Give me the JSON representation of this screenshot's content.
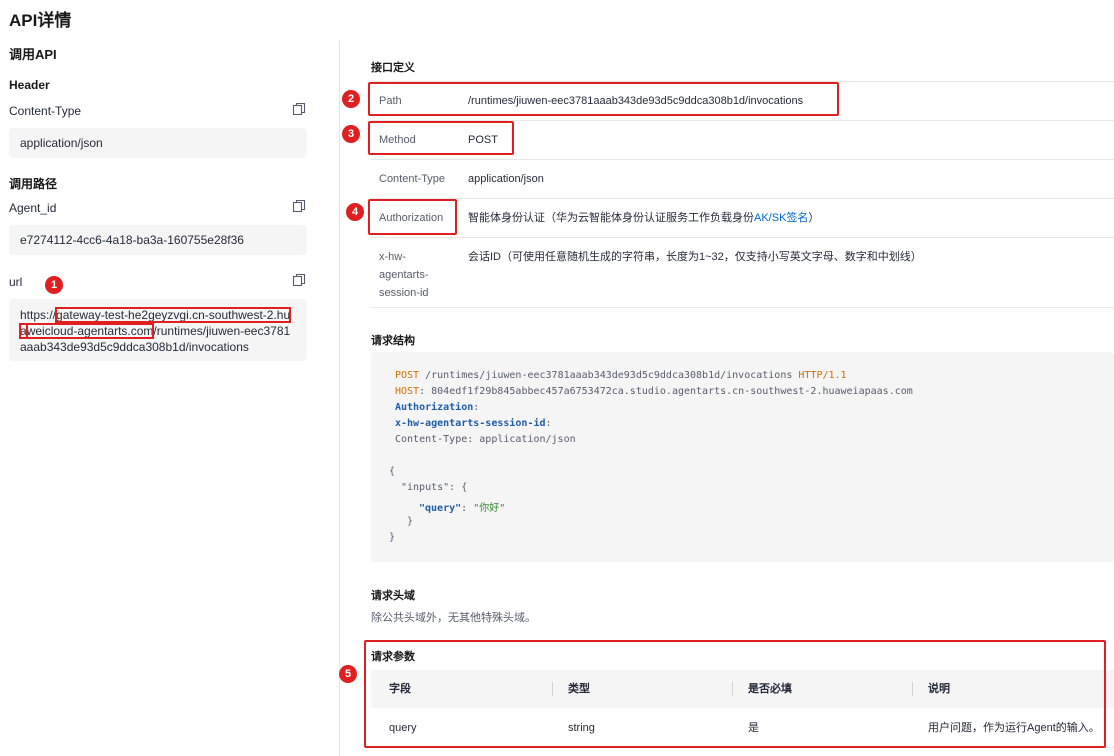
{
  "page": {
    "title": "API详情"
  },
  "left": {
    "heading": "调用API",
    "header_section": "Header",
    "content_type_label": "Content-Type",
    "content_type_value": "application/json",
    "path_section": "调用路径",
    "agent_id_label": "Agent_id",
    "agent_id_value": "e7274112-4cc6-4a18-ba3a-160755e28f36",
    "url_label": "url",
    "url_prefix": "https://",
    "url_highlight_1": "gateway-test-he2geyzvgi.cn-southwest-2.hua",
    "url_highlight_2": "weicloud-agentarts.com",
    "url_suffix": "/runtimes/jiuwen-eec3781aaab343de93d5c9ddca308b1d/invocations",
    "copy_icon": "copy-icon"
  },
  "definition": {
    "title": "接口定义",
    "rows": [
      {
        "key": "Path",
        "value": "/runtimes/jiuwen-eec3781aaab343de93d5c9ddca308b1d/invocations"
      },
      {
        "key": "Method",
        "value": "POST"
      },
      {
        "key": "Content-Type",
        "value": "application/json"
      },
      {
        "key": "Authorization",
        "value": "智能体身份认证（华为云智能体身份认证服务工作负载身份",
        "link": "AK/SK签名",
        "value_end": "）"
      },
      {
        "key_lines": [
          "x-hw-",
          "agentarts-",
          "session-id"
        ],
        "value": "会话ID（可使用任意随机生成的字符串，长度为1~32，仅支持小写英文字母、数字和中划线）"
      }
    ]
  },
  "request_structure": {
    "title": "请求结构",
    "line1_method": "POST",
    "line1_path": " /runtimes/jiuwen-eec3781aaab343de93d5c9ddca308b1d/invocations ",
    "line1_proto": "HTTP/1.1",
    "line2_key": "HOST",
    "line2_value": ": 804edf1f29b845abbec457a6753472ca.studio.agentarts.cn-southwest-2.huaweiapaas.com",
    "line3_key": "Authorization",
    "line3_colon": ":",
    "line4_key": "x-hw-agentarts-session-id",
    "line4_colon": ":",
    "line5": "Content-Type: application/json",
    "body_open": "{",
    "body_inputs": "\"inputs\": {",
    "body_query_key": "\"query\"",
    "body_query_sep": ": ",
    "body_query_value": "\"你好\"",
    "body_inner_close": "}",
    "body_close": "}"
  },
  "request_headers": {
    "title": "请求头域",
    "note": "除公共头域外，无其他特殊头域。"
  },
  "request_params": {
    "title": "请求参数",
    "columns": [
      "字段",
      "类型",
      "是否必填",
      "说明"
    ],
    "rows": [
      [
        "query",
        "string",
        "是",
        "用户问题，作为运行Agent的输入。"
      ]
    ]
  },
  "annotations": [
    "1",
    "2",
    "3",
    "4",
    "5"
  ],
  "colors": {
    "annotation": "#e02020",
    "link": "#0067d1"
  }
}
